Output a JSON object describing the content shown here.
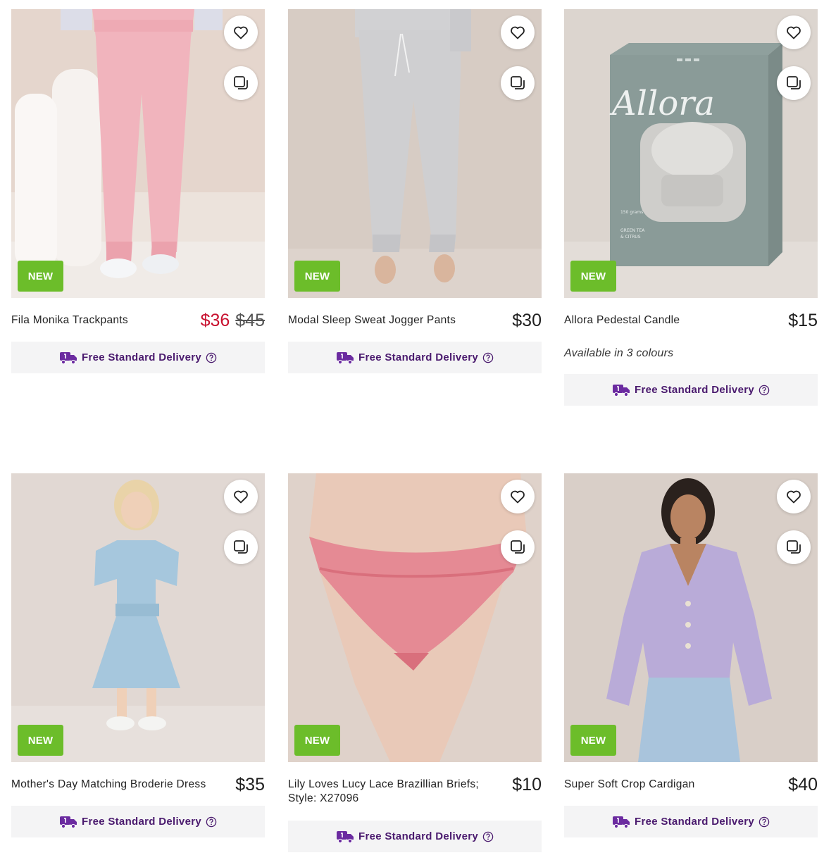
{
  "products": [
    {
      "name": "Fila Monika Trackpants",
      "price": "$36",
      "was_price": "$45",
      "badge": "NEW",
      "delivery": "Free Standard Delivery"
    },
    {
      "name": "Modal Sleep Sweat Jogger Pants",
      "price": "$30",
      "badge": "NEW",
      "delivery": "Free Standard Delivery"
    },
    {
      "name": "Allora Pedestal Candle",
      "price": "$15",
      "badge": "NEW",
      "colours": "Available in 3 colours",
      "delivery": "Free Standard Delivery",
      "box_text": "Allora",
      "box_small_1": "150 grams",
      "box_small_2": "GREEN TEA",
      "box_small_3": "& CITRUS"
    },
    {
      "name": "Mother's Day Matching Broderie Dress",
      "price": "$35",
      "badge": "NEW",
      "delivery": "Free Standard Delivery"
    },
    {
      "name": "Lily Loves Lucy Lace Brazillian Briefs; Style: X27096",
      "price": "$10",
      "badge": "NEW",
      "delivery": "Free Standard Delivery"
    },
    {
      "name": "Super Soft Crop Cardigan",
      "price": "$40",
      "badge": "NEW",
      "delivery": "Free Standard Delivery"
    }
  ],
  "colors": {
    "sale_price": "#c8102e",
    "badge_bg": "#6cbd2a",
    "delivery_text": "#4a1a6e",
    "delivery_icon": "#6b2ba0"
  },
  "icons": {
    "wishlist": "heart-icon",
    "compare": "compare-icon",
    "delivery": "truck-icon",
    "help": "question-icon"
  }
}
